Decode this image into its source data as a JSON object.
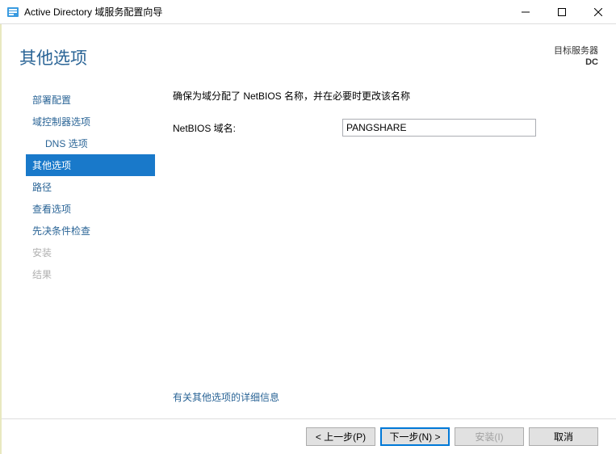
{
  "window": {
    "title": "Active Directory 域服务配置向导"
  },
  "header": {
    "page_title": "其他选项",
    "target_label": "目标服务器",
    "target_server": "DC"
  },
  "sidebar": {
    "items": [
      {
        "label": "部署配置"
      },
      {
        "label": "域控制器选项"
      },
      {
        "label": "DNS 选项"
      },
      {
        "label": "其他选项"
      },
      {
        "label": "路径"
      },
      {
        "label": "查看选项"
      },
      {
        "label": "先决条件检查"
      },
      {
        "label": "安装"
      },
      {
        "label": "结果"
      }
    ]
  },
  "main": {
    "instruction": "确保为域分配了 NetBIOS 名称，并在必要时更改该名称",
    "netbios_label": "NetBIOS 域名:",
    "netbios_value": "PANGSHARE",
    "more_link": "有关其他选项的详细信息"
  },
  "footer": {
    "prev": "< 上一步(P)",
    "next": "下一步(N) >",
    "install": "安装(I)",
    "cancel": "取消"
  }
}
